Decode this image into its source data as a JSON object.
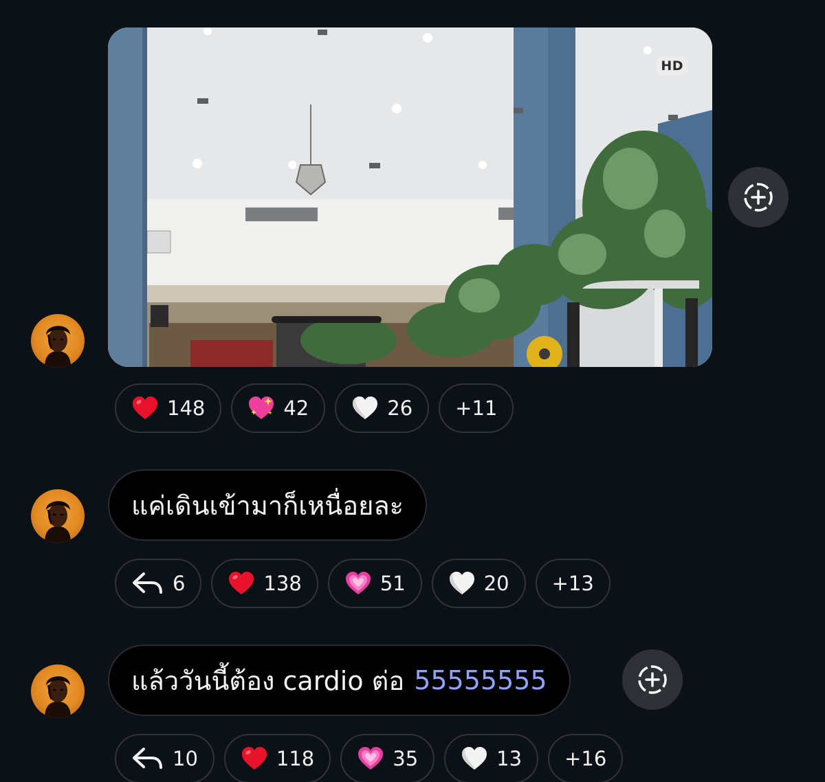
{
  "photo": {
    "badge": "HD"
  },
  "messages": [
    {
      "reactions": [
        {
          "icon": "red-heart-icon",
          "count": "148"
        },
        {
          "icon": "sparkling-heart-icon",
          "count": "42"
        },
        {
          "icon": "white-heart-icon",
          "count": "26"
        }
      ],
      "more": "+11"
    },
    {
      "text": "แค่เดินเข้ามาก็เหนื่อยละ",
      "replies": "6",
      "reactions": [
        {
          "icon": "red-heart-icon",
          "count": "138"
        },
        {
          "icon": "pink-heart-icon",
          "count": "51"
        },
        {
          "icon": "white-heart-icon",
          "count": "20"
        }
      ],
      "more": "+13"
    },
    {
      "text": "แล้ววันนี้ต้อง cardio ต่อ",
      "link_text": "55555555",
      "replies": "10",
      "reactions": [
        {
          "icon": "red-heart-icon",
          "count": "118"
        },
        {
          "icon": "pink-heart-icon",
          "count": "35"
        },
        {
          "icon": "white-heart-icon",
          "count": "13"
        }
      ],
      "more": "+16"
    }
  ],
  "colors": {
    "background": "#0c1117",
    "bubble": "#000000",
    "chip_border": "#2f333a",
    "link": "#8ea4ff",
    "react_button": "#2e3136"
  }
}
